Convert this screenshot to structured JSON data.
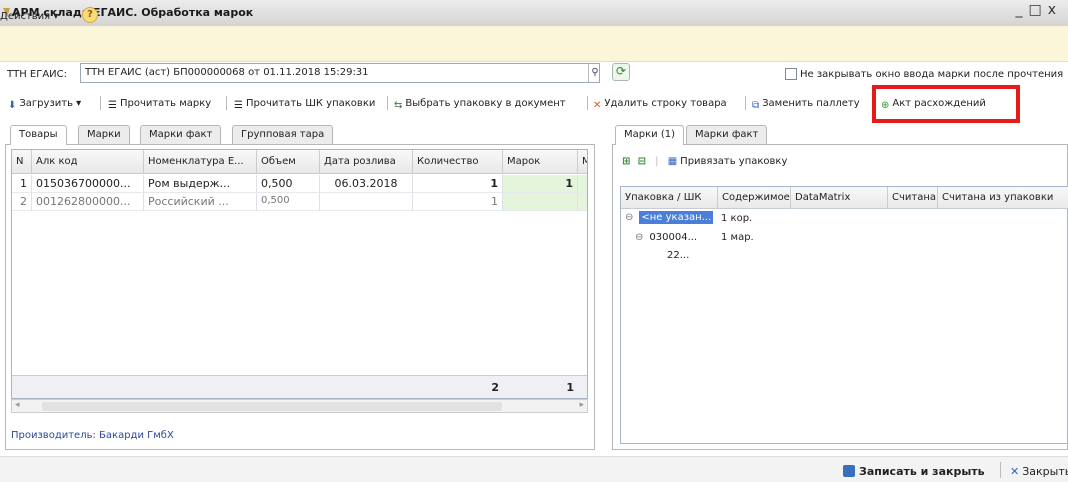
{
  "window": {
    "title": "АРМ склада ЕГАИС. Обработка марок"
  },
  "menu": {
    "actions_label": "Действия",
    "help_glyph": "?"
  },
  "document": {
    "label": "ТТН ЕГАИС:",
    "value": "ТТН ЕГАИС (аст) БП000000068 от 01.11.2018 15:29:31",
    "keep_open_label": "Не закрывать окно ввода марки после прочтения"
  },
  "toolbar": {
    "load": "Загрузить",
    "read_mark": "Прочитать марку",
    "read_pack_barcode": "Прочитать ШК упаковки",
    "select_pack": "Выбрать упаковку в документ",
    "delete_row": "Удалить строку товара",
    "replace_pallet": "Заменить паллету",
    "discrepancy_act": "Акт расхождений"
  },
  "left_tabs": [
    "Товары",
    "Марки",
    "Марки факт",
    "Групповая тара"
  ],
  "goods_table": {
    "columns": [
      "N",
      "Алк код",
      "Номенклатура Е...",
      "Объем",
      "Дата розлива",
      "Количество",
      "Марок",
      "Ма"
    ],
    "rows": [
      {
        "n": "1",
        "code": "015036700000...",
        "name": "Ром выдерж...",
        "volume": "0,500",
        "date": "06.03.2018",
        "qty": "1",
        "marks": "1"
      },
      {
        "n": "2",
        "code": "001262800000...",
        "name": "Российский ...",
        "volume": "0,500",
        "date": "",
        "qty": "1",
        "marks": ""
      }
    ],
    "totals": {
      "qty": "2",
      "marks": "1"
    }
  },
  "producer": "Производитель: Бакарди ГмбХ",
  "right_tabs": [
    "Марки (1)",
    "Марки факт"
  ],
  "right_toolbar": {
    "bind_pack": "Привязать упаковку"
  },
  "marks_table": {
    "columns": [
      "Упаковка / ШК",
      "Содержимое",
      "DataMatrix",
      "Считана",
      "Считана из упаковки"
    ],
    "tree": [
      {
        "toggle": "⊖",
        "pack": "<не указан...",
        "content": "1 кор."
      },
      {
        "toggle": "⊖",
        "pack": "030004...",
        "content": "1 мар."
      },
      {
        "toggle": "",
        "pack": "22...",
        "content": ""
      }
    ]
  },
  "bottom": {
    "save_close": "Записать и закрыть",
    "close": "Закрыть"
  },
  "colors": {
    "highlight_border": "#e41b1b",
    "menu_bg": "#fbf6d9",
    "selection": "#4a7ed8",
    "marks_cell": "#e4f5dc"
  }
}
